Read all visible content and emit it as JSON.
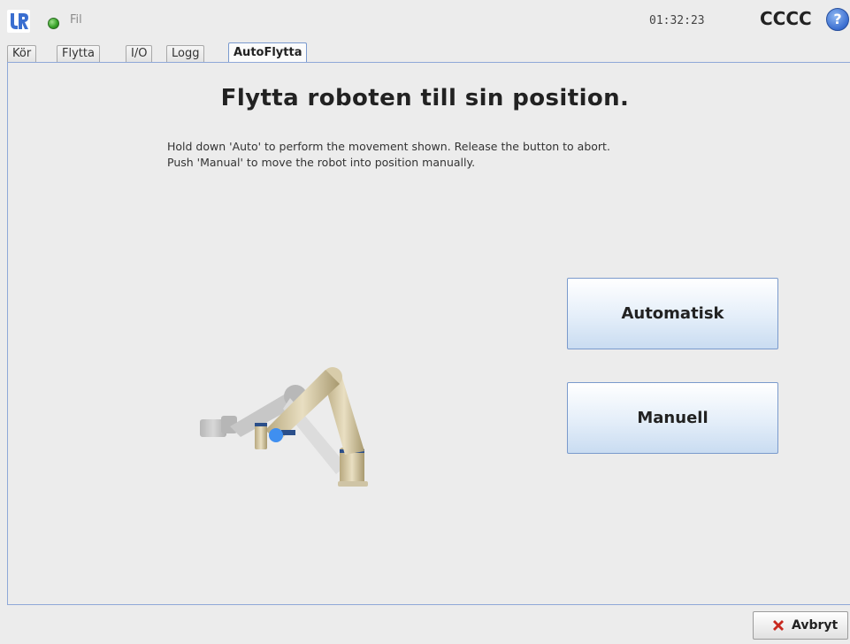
{
  "header": {
    "logo": "UR",
    "file_menu": "Fil",
    "clock": "01:32:23",
    "robot_name": "CCCC",
    "help_icon": "?"
  },
  "tabs": [
    {
      "label": "Kör",
      "active": false
    },
    {
      "label": "Flytta",
      "active": false
    },
    {
      "label": "I/O",
      "active": false
    },
    {
      "label": "Logg",
      "active": false
    },
    {
      "label": "AutoFlytta",
      "active": true
    }
  ],
  "main": {
    "title": "Flytta roboten till sin position.",
    "instruction_line1": "Hold down 'Auto' to perform the movement shown. Release the button to abort.",
    "instruction_line2": "Push 'Manual' to move the robot into position manually.",
    "auto_button": "Automatisk",
    "manual_button": "Manuell"
  },
  "footer": {
    "cancel_label": "Avbryt"
  },
  "colors": {
    "status_ok": "#3aa52b",
    "accent": "#3a6ed0",
    "cancel_x": "#c8281e"
  }
}
